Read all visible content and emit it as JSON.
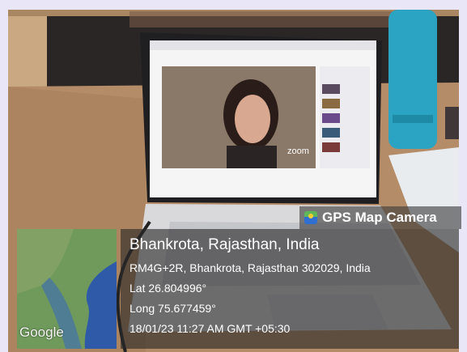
{
  "watermark_title": "GPS Map Camera",
  "location": {
    "place": "Bhankrota, Rajasthan, India",
    "address": "RM4G+2R, Bhankrota, Rajasthan 302029, India",
    "lat": "Lat 26.804996°",
    "long": "Long 75.677459°",
    "datetime": "18/01/23 11:27 AM GMT +05:30"
  },
  "map": {
    "provider": "Google"
  },
  "screen": {
    "video_badge": "zoom"
  },
  "colors": {
    "desk": "#b58c68",
    "wall": "#2b2626",
    "bottle": "#2aa4c2",
    "laptop": "#d9d9dc"
  }
}
